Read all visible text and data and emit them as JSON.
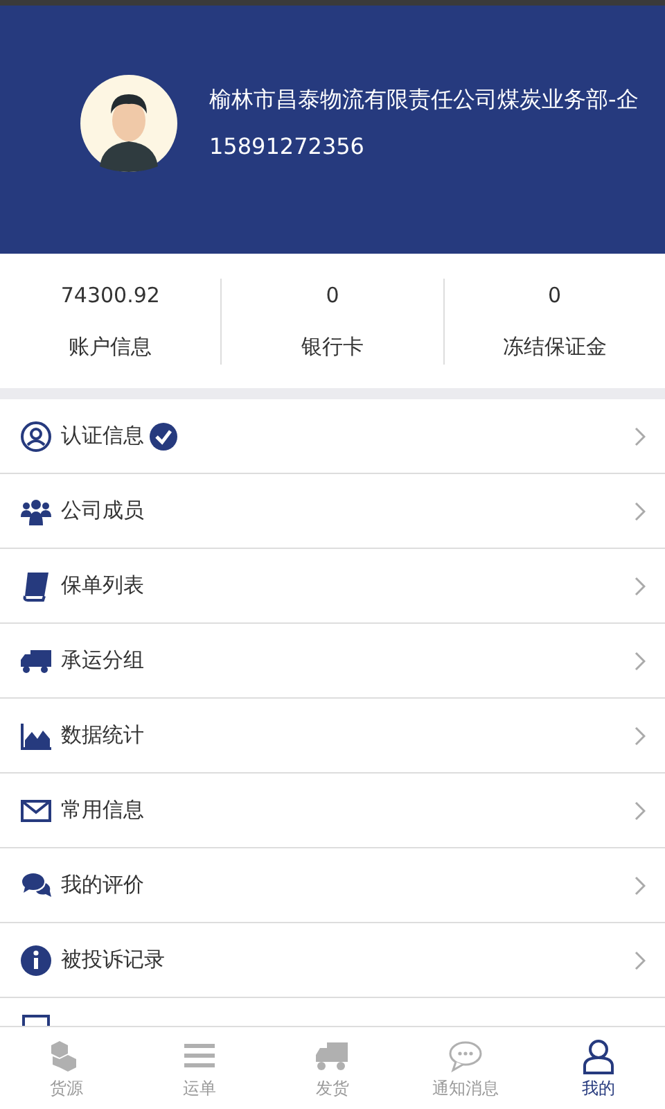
{
  "profile": {
    "name": "榆林市昌泰物流有限责任公司煤炭业务部-企",
    "phone": "15891272356"
  },
  "stats": [
    {
      "value": "74300.92",
      "label": "账户信息"
    },
    {
      "value": "0",
      "label": "银行卡"
    },
    {
      "value": "0",
      "label": "冻结保证金"
    }
  ],
  "menu": [
    {
      "label": "认证信息",
      "verified": true
    },
    {
      "label": "公司成员",
      "verified": false
    },
    {
      "label": "保单列表",
      "verified": false
    },
    {
      "label": "承运分组",
      "verified": false
    },
    {
      "label": "数据统计",
      "verified": false
    },
    {
      "label": "常用信息",
      "verified": false
    },
    {
      "label": "我的评价",
      "verified": false
    },
    {
      "label": "被投诉记录",
      "verified": false
    }
  ],
  "tabs": [
    {
      "label": "货源",
      "selected": false
    },
    {
      "label": "运单",
      "selected": false
    },
    {
      "label": "发货",
      "selected": false
    },
    {
      "label": "通知消息",
      "selected": false
    },
    {
      "label": "我的",
      "selected": true
    }
  ]
}
